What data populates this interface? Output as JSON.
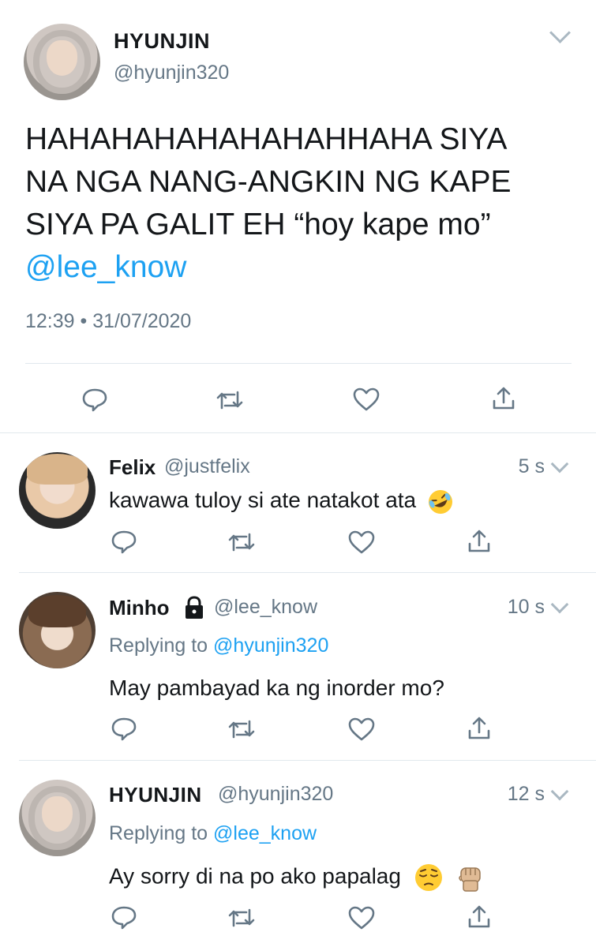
{
  "main_tweet": {
    "author_name": "HYUNJIN",
    "author_handle": "@hyunjin320",
    "text_line1": "HAHAHAHAHAHAHAHHAHA SIYA",
    "text_line2": "NA NGA NANG-ANGKIN NG KAPE",
    "text_line3": "SIYA PA GALIT EH “hoy kape mo”",
    "mention": "@lee_know",
    "timestamp": "12:39 • 31/07/2020"
  },
  "replies": [
    {
      "name": "Felix",
      "handle": "@justfelix",
      "time": "5 s",
      "text": "kawawa tuloy si ate natakot ata",
      "emoji": "rofl-emoji"
    },
    {
      "name": "Minho",
      "handle": "@lee_know",
      "time": "10 s",
      "replying_prefix": "Replying to",
      "replying_to": "@hyunjin320",
      "text": "May pambayad ka ng inorder mo?",
      "badge": "lock-icon"
    },
    {
      "name": "HYUNJIN",
      "handle": "@hyunjin320",
      "time": "12 s",
      "replying_prefix": "Replying to",
      "replying_to": "@lee_know",
      "text": "Ay sorry di na po ako papalag",
      "emoji": [
        "pensive-emoji",
        "raised-fist-emoji"
      ]
    }
  ],
  "icons": [
    "reply-icon",
    "retweet-icon",
    "like-icon",
    "share-icon",
    "chevron-down-icon"
  ],
  "colors": {
    "link": "#1da1f2",
    "secondary": "#657786",
    "divider": "#e1e8ed",
    "icon": "#657786"
  }
}
